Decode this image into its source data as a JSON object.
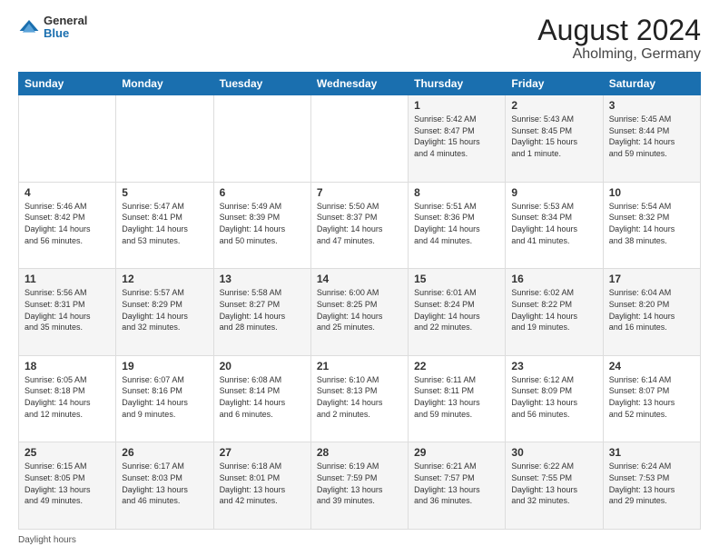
{
  "header": {
    "logo_general": "General",
    "logo_blue": "Blue",
    "main_title": "August 2024",
    "subtitle": "Aholming, Germany"
  },
  "calendar": {
    "days_of_week": [
      "Sunday",
      "Monday",
      "Tuesday",
      "Wednesday",
      "Thursday",
      "Friday",
      "Saturday"
    ],
    "weeks": [
      [
        {
          "date": "",
          "info": ""
        },
        {
          "date": "",
          "info": ""
        },
        {
          "date": "",
          "info": ""
        },
        {
          "date": "",
          "info": ""
        },
        {
          "date": "1",
          "info": "Sunrise: 5:42 AM\nSunset: 8:47 PM\nDaylight: 15 hours\nand 4 minutes."
        },
        {
          "date": "2",
          "info": "Sunrise: 5:43 AM\nSunset: 8:45 PM\nDaylight: 15 hours\nand 1 minute."
        },
        {
          "date": "3",
          "info": "Sunrise: 5:45 AM\nSunset: 8:44 PM\nDaylight: 14 hours\nand 59 minutes."
        }
      ],
      [
        {
          "date": "4",
          "info": "Sunrise: 5:46 AM\nSunset: 8:42 PM\nDaylight: 14 hours\nand 56 minutes."
        },
        {
          "date": "5",
          "info": "Sunrise: 5:47 AM\nSunset: 8:41 PM\nDaylight: 14 hours\nand 53 minutes."
        },
        {
          "date": "6",
          "info": "Sunrise: 5:49 AM\nSunset: 8:39 PM\nDaylight: 14 hours\nand 50 minutes."
        },
        {
          "date": "7",
          "info": "Sunrise: 5:50 AM\nSunset: 8:37 PM\nDaylight: 14 hours\nand 47 minutes."
        },
        {
          "date": "8",
          "info": "Sunrise: 5:51 AM\nSunset: 8:36 PM\nDaylight: 14 hours\nand 44 minutes."
        },
        {
          "date": "9",
          "info": "Sunrise: 5:53 AM\nSunset: 8:34 PM\nDaylight: 14 hours\nand 41 minutes."
        },
        {
          "date": "10",
          "info": "Sunrise: 5:54 AM\nSunset: 8:32 PM\nDaylight: 14 hours\nand 38 minutes."
        }
      ],
      [
        {
          "date": "11",
          "info": "Sunrise: 5:56 AM\nSunset: 8:31 PM\nDaylight: 14 hours\nand 35 minutes."
        },
        {
          "date": "12",
          "info": "Sunrise: 5:57 AM\nSunset: 8:29 PM\nDaylight: 14 hours\nand 32 minutes."
        },
        {
          "date": "13",
          "info": "Sunrise: 5:58 AM\nSunset: 8:27 PM\nDaylight: 14 hours\nand 28 minutes."
        },
        {
          "date": "14",
          "info": "Sunrise: 6:00 AM\nSunset: 8:25 PM\nDaylight: 14 hours\nand 25 minutes."
        },
        {
          "date": "15",
          "info": "Sunrise: 6:01 AM\nSunset: 8:24 PM\nDaylight: 14 hours\nand 22 minutes."
        },
        {
          "date": "16",
          "info": "Sunrise: 6:02 AM\nSunset: 8:22 PM\nDaylight: 14 hours\nand 19 minutes."
        },
        {
          "date": "17",
          "info": "Sunrise: 6:04 AM\nSunset: 8:20 PM\nDaylight: 14 hours\nand 16 minutes."
        }
      ],
      [
        {
          "date": "18",
          "info": "Sunrise: 6:05 AM\nSunset: 8:18 PM\nDaylight: 14 hours\nand 12 minutes."
        },
        {
          "date": "19",
          "info": "Sunrise: 6:07 AM\nSunset: 8:16 PM\nDaylight: 14 hours\nand 9 minutes."
        },
        {
          "date": "20",
          "info": "Sunrise: 6:08 AM\nSunset: 8:14 PM\nDaylight: 14 hours\nand 6 minutes."
        },
        {
          "date": "21",
          "info": "Sunrise: 6:10 AM\nSunset: 8:13 PM\nDaylight: 14 hours\nand 2 minutes."
        },
        {
          "date": "22",
          "info": "Sunrise: 6:11 AM\nSunset: 8:11 PM\nDaylight: 13 hours\nand 59 minutes."
        },
        {
          "date": "23",
          "info": "Sunrise: 6:12 AM\nSunset: 8:09 PM\nDaylight: 13 hours\nand 56 minutes."
        },
        {
          "date": "24",
          "info": "Sunrise: 6:14 AM\nSunset: 8:07 PM\nDaylight: 13 hours\nand 52 minutes."
        }
      ],
      [
        {
          "date": "25",
          "info": "Sunrise: 6:15 AM\nSunset: 8:05 PM\nDaylight: 13 hours\nand 49 minutes."
        },
        {
          "date": "26",
          "info": "Sunrise: 6:17 AM\nSunset: 8:03 PM\nDaylight: 13 hours\nand 46 minutes."
        },
        {
          "date": "27",
          "info": "Sunrise: 6:18 AM\nSunset: 8:01 PM\nDaylight: 13 hours\nand 42 minutes."
        },
        {
          "date": "28",
          "info": "Sunrise: 6:19 AM\nSunset: 7:59 PM\nDaylight: 13 hours\nand 39 minutes."
        },
        {
          "date": "29",
          "info": "Sunrise: 6:21 AM\nSunset: 7:57 PM\nDaylight: 13 hours\nand 36 minutes."
        },
        {
          "date": "30",
          "info": "Sunrise: 6:22 AM\nSunset: 7:55 PM\nDaylight: 13 hours\nand 32 minutes."
        },
        {
          "date": "31",
          "info": "Sunrise: 6:24 AM\nSunset: 7:53 PM\nDaylight: 13 hours\nand 29 minutes."
        }
      ]
    ]
  },
  "footer": {
    "text": "Daylight hours"
  }
}
